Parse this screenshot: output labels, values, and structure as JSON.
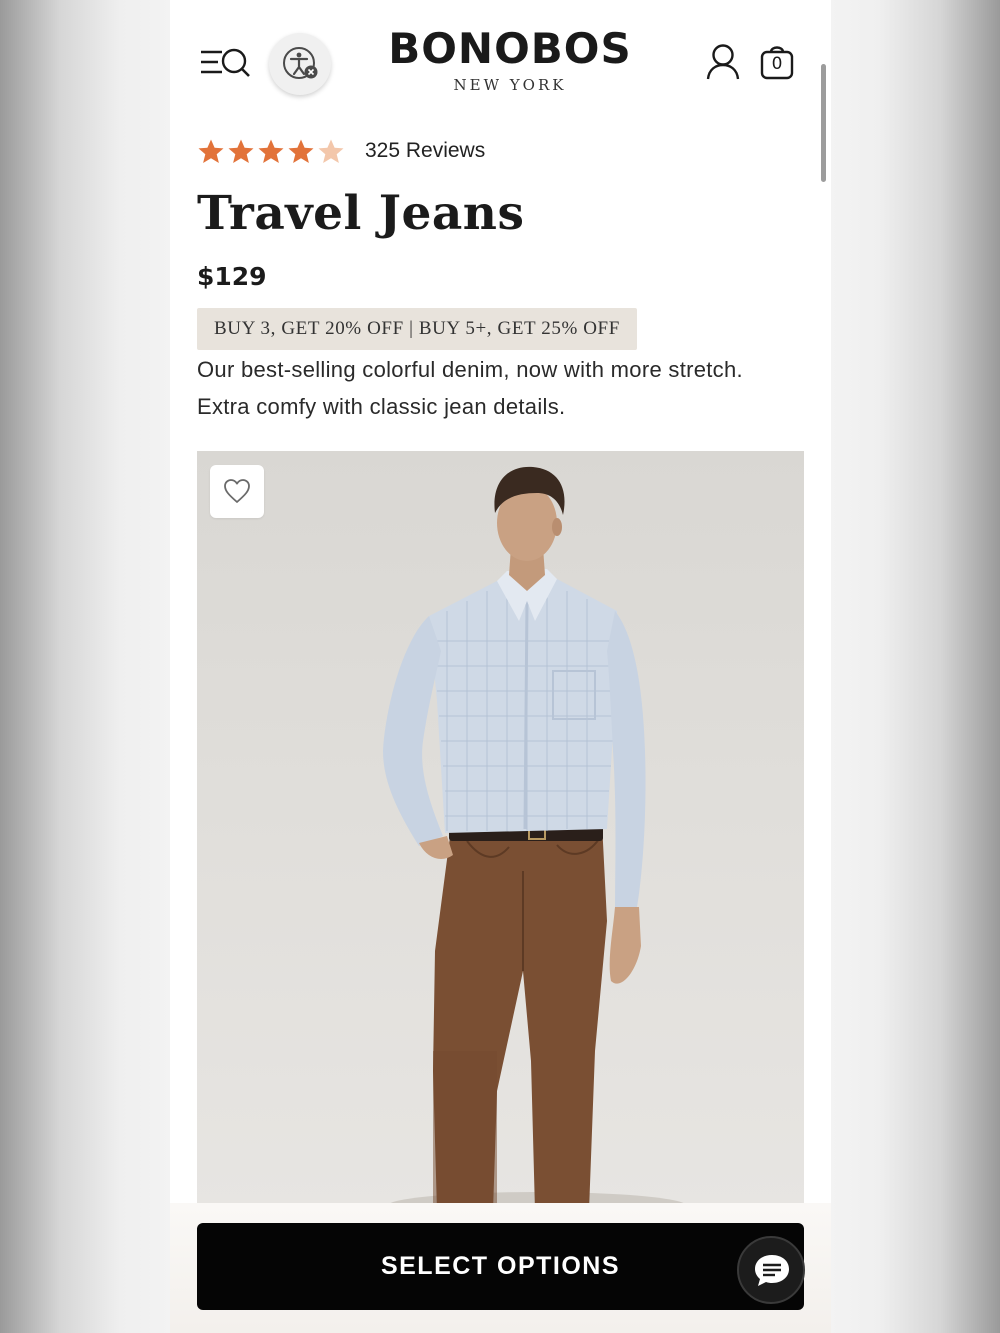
{
  "header": {
    "brand_name": "BONOBOS",
    "brand_location": "NEW YORK",
    "bag_count": "0"
  },
  "product": {
    "rating": 4.5,
    "rating_max": 5,
    "review_count_label": "325 Reviews",
    "title": "Travel Jeans",
    "price": "$129",
    "promo": "BUY 3, GET 20% OFF | BUY 5+, GET 25% OFF",
    "description": "Our best-selling colorful denim, now with more stretch. Extra comfy with classic jean details.",
    "image": {
      "subject": "model wearing blue check shirt and brown jeans"
    }
  },
  "actions": {
    "select_options_label": "SELECT OPTIONS"
  },
  "colors": {
    "star": "#e2733a",
    "star_empty": "#f3c7ab",
    "promo_bg": "#e8e3dc",
    "cta_bg": "#050505"
  },
  "icons": {
    "menu": "menu-search-icon",
    "accessibility": "accessibility-icon",
    "account": "account-icon",
    "bag": "shopping-bag-icon",
    "wishlist": "heart-icon",
    "chat": "chat-icon"
  }
}
